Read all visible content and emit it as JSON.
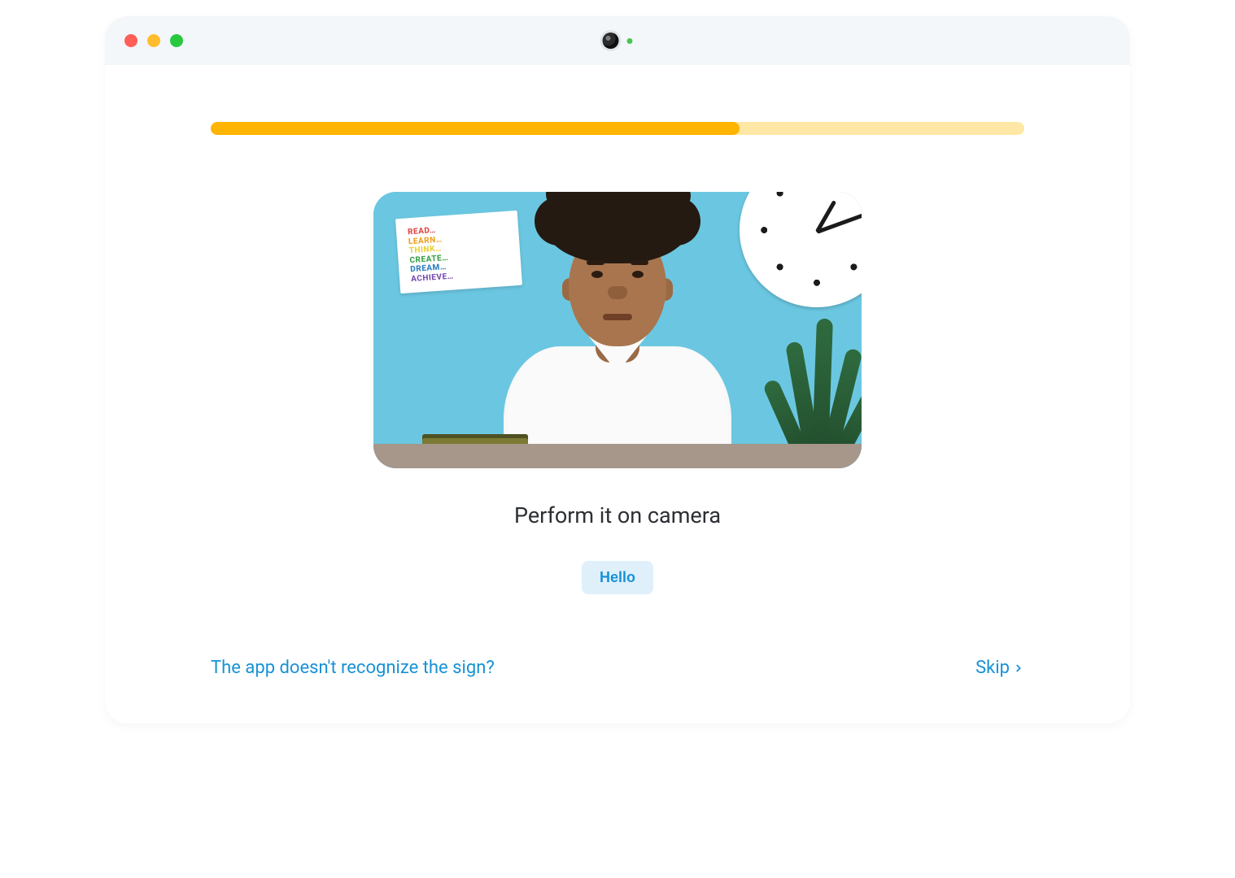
{
  "progress": {
    "percent": 65
  },
  "preview": {
    "poster_lines": [
      "READ…",
      "LEARN…",
      "THINK…",
      "CREATE…",
      "DREAM…",
      "ACHIEVE…"
    ]
  },
  "instruction": "Perform it on camera",
  "chip": {
    "label": "Hello"
  },
  "footer": {
    "help": "The app doesn't recognize the sign?",
    "skip": "Skip"
  },
  "colors": {
    "accent_blue": "#1792d6",
    "progress_fill": "#ffb400",
    "progress_track": "#ffe8a6"
  }
}
